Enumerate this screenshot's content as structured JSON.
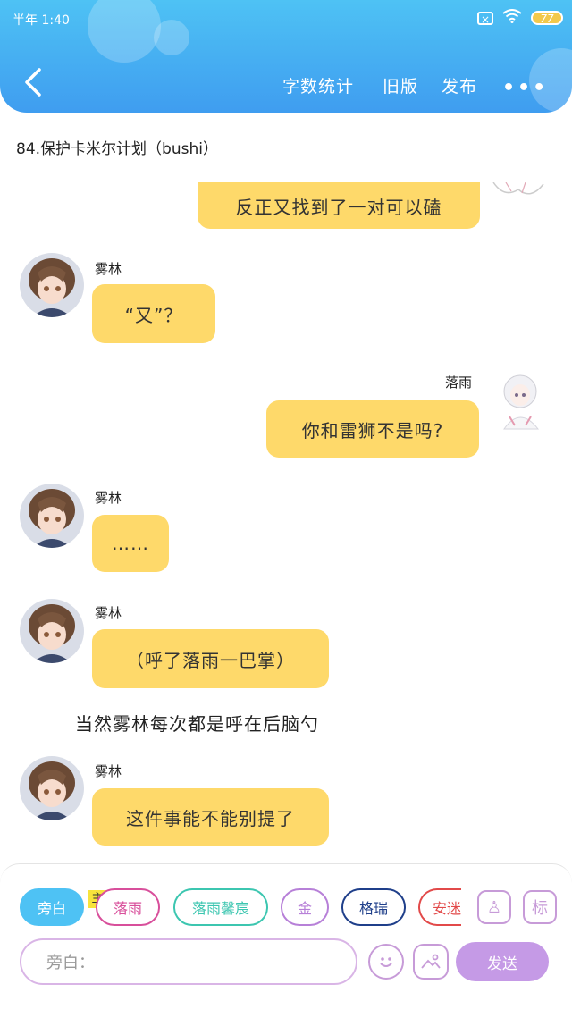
{
  "status_bar": {
    "time": "半年 1:40",
    "battery": "77"
  },
  "header": {
    "word_count": "字数统计",
    "old_version": "旧版",
    "publish": "发布",
    "more": "•••"
  },
  "story_title": "84.保护卡米尔计划（bushi）",
  "messages": [
    {
      "side": "right",
      "speaker": "",
      "text": "反正又找到了一对可以磕"
    },
    {
      "side": "left",
      "speaker": "雾林",
      "text": "“又”？"
    },
    {
      "side": "right",
      "speaker": "落雨",
      "text": "你和雷狮不是吗?"
    },
    {
      "side": "left",
      "speaker": "雾林",
      "text": "……"
    },
    {
      "side": "left",
      "speaker": "雾林",
      "text": "（呼了落雨一巴掌）"
    },
    {
      "side": "narration",
      "speaker": "",
      "text": "当然雾林每次都是呼在后脑勺"
    },
    {
      "side": "left",
      "speaker": "雾林",
      "text": "这件事能不能别提了"
    }
  ],
  "chips": [
    {
      "label": "旁白",
      "color": "#4ec2f4"
    },
    {
      "label": "落雨",
      "color": "#d84f9b"
    },
    {
      "label": "落雨馨宸",
      "color": "#3cc6b0"
    },
    {
      "label": "金",
      "color": "#b780d8"
    },
    {
      "label": "格瑞",
      "color": "#1f3f8a"
    },
    {
      "label": "安迷",
      "color": "#e24a4a"
    }
  ],
  "main_tag": "主",
  "square_buttons": {
    "role": "♙",
    "mark": "标"
  },
  "input": {
    "placeholder": "旁白："
  },
  "send_label": "发送"
}
